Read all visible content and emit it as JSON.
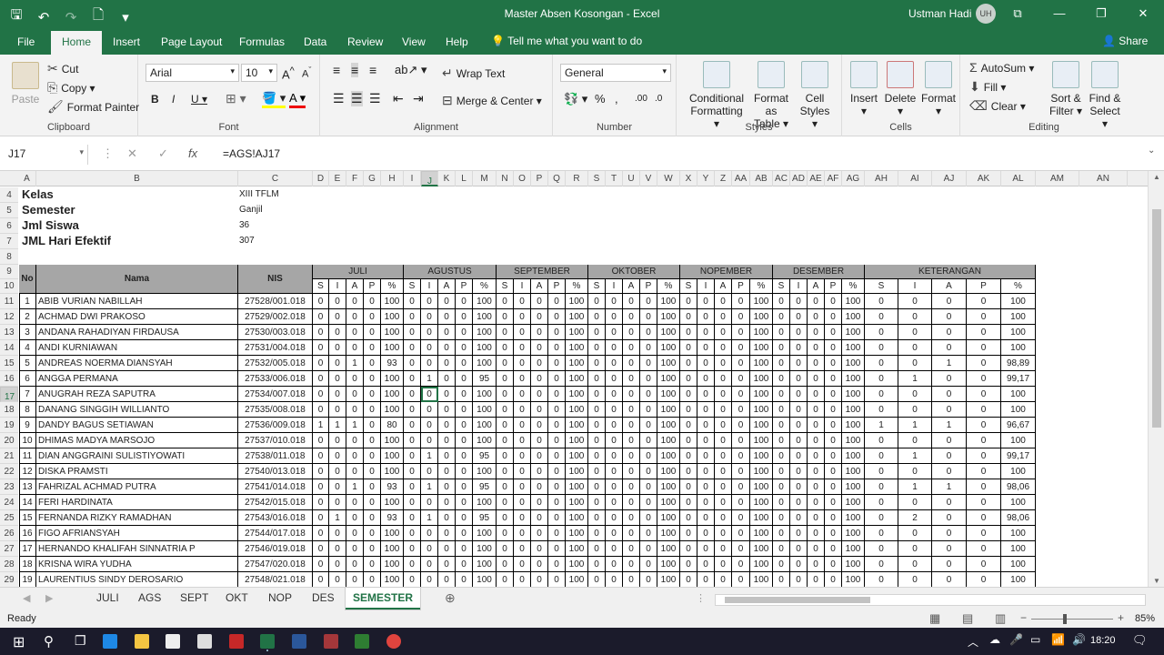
{
  "titlebar": {
    "title": "Master Absen Kosongan  -  Excel",
    "user": "Ustman Hadi",
    "initials": "UH"
  },
  "ribbon_tabs": [
    "File",
    "Home",
    "Insert",
    "Page Layout",
    "Formulas",
    "Data",
    "Review",
    "View",
    "Help"
  ],
  "tell_me": "Tell me what you want to do",
  "share": "Share",
  "clipboard": {
    "paste": "Paste",
    "cut": "Cut",
    "copy": "Copy",
    "painter": "Format Painter",
    "label": "Clipboard"
  },
  "font": {
    "name": "Arial",
    "size": "10",
    "label": "Font"
  },
  "alignment": {
    "wrap": "Wrap Text",
    "merge": "Merge & Center",
    "label": "Alignment"
  },
  "number": {
    "format": "General",
    "label": "Number"
  },
  "styles": {
    "cond": "Conditional",
    "cond2": "Formatting",
    "fmt": "Format as",
    "fmt2": "Table",
    "cell": "Cell",
    "cell2": "Styles",
    "label": "Styles"
  },
  "cells": {
    "insert": "Insert",
    "delete": "Delete",
    "format": "Format",
    "label": "Cells"
  },
  "editing": {
    "autosum": "AutoSum",
    "fill": "Fill",
    "clear": "Clear",
    "sort": "Sort &",
    "sort2": "Filter",
    "find": "Find &",
    "find2": "Select",
    "label": "Editing"
  },
  "namebox": "J17",
  "formula": "=AGS!AJ17",
  "columns": [
    "A",
    "B",
    "C",
    "D",
    "E",
    "F",
    "G",
    "H",
    "I",
    "J",
    "K",
    "L",
    "M",
    "N",
    "O",
    "P",
    "Q",
    "R",
    "S",
    "T",
    "U",
    "V",
    "W",
    "X",
    "Y",
    "Z",
    "AA",
    "AB",
    "AC",
    "AD",
    "AE",
    "AF",
    "AG",
    "AH",
    "AI",
    "AJ",
    "AK",
    "AL",
    "AM",
    "AN"
  ],
  "info": [
    {
      "label": "Kelas",
      "value": "XIII TFLM"
    },
    {
      "label": "Semester",
      "value": "Ganjil"
    },
    {
      "label": "Jml Siswa",
      "value": "36"
    },
    {
      "label": "JML Hari Efektif",
      "value": "307"
    }
  ],
  "table_header": {
    "no": "No",
    "nama": "Nama",
    "nis": "NIS",
    "months": [
      "JULI",
      "AGUSTUS",
      "SEPTEMBER",
      "OKTOBER",
      "NOPEMBER",
      "DESEMBER",
      "KETERANGAN"
    ],
    "sub": [
      "S",
      "I",
      "A",
      "P",
      "%"
    ]
  },
  "students": [
    [
      "1",
      "ABIB VURIAN NABILLAH",
      "27528/001.018",
      "0,0,0,0,100",
      "0,0,0,0,100",
      "0,0,0,0,100",
      "0,0,0,0,100",
      "0,0,0,0,100",
      "0,0,0,0,100",
      "0,0,0,0,100"
    ],
    [
      "2",
      "ACHMAD DWI PRAKOSO",
      "27529/002.018",
      "0,0,0,0,100",
      "0,0,0,0,100",
      "0,0,0,0,100",
      "0,0,0,0,100",
      "0,0,0,0,100",
      "0,0,0,0,100",
      "0,0,0,0,100"
    ],
    [
      "3",
      "ANDANA RAHADIYAN FIRDAUSA",
      "27530/003.018",
      "0,0,0,0,100",
      "0,0,0,0,100",
      "0,0,0,0,100",
      "0,0,0,0,100",
      "0,0,0,0,100",
      "0,0,0,0,100",
      "0,0,0,0,100"
    ],
    [
      "4",
      "ANDI KURNIAWAN",
      "27531/004.018",
      "0,0,0,0,100",
      "0,0,0,0,100",
      "0,0,0,0,100",
      "0,0,0,0,100",
      "0,0,0,0,100",
      "0,0,0,0,100",
      "0,0,0,0,100"
    ],
    [
      "5",
      "ANDREAS NOERMA DIANSYAH",
      "27532/005.018",
      "0,0,1,0,93",
      "0,0,0,0,100",
      "0,0,0,0,100",
      "0,0,0,0,100",
      "0,0,0,0,100",
      "0,0,0,0,100",
      "0,0,1,0,98,89"
    ],
    [
      "6",
      "ANGGA PERMANA",
      "27533/006.018",
      "0,0,0,0,100",
      "0,1,0,0,95",
      "0,0,0,0,100",
      "0,0,0,0,100",
      "0,0,0,0,100",
      "0,0,0,0,100",
      "0,1,0,0,99,17"
    ],
    [
      "7",
      "ANUGRAH REZA SAPUTRA",
      "27534/007.018",
      "0,0,0,0,100",
      "0,0,0,0,100",
      "0,0,0,0,100",
      "0,0,0,0,100",
      "0,0,0,0,100",
      "0,0,0,0,100",
      "0,0,0,0,100"
    ],
    [
      "8",
      "DANANG SINGGIH WILLIANTO",
      "27535/008.018",
      "0,0,0,0,100",
      "0,0,0,0,100",
      "0,0,0,0,100",
      "0,0,0,0,100",
      "0,0,0,0,100",
      "0,0,0,0,100",
      "0,0,0,0,100"
    ],
    [
      "9",
      "DANDY BAGUS SETIAWAN",
      "27536/009.018",
      "1,1,1,0,80",
      "0,0,0,0,100",
      "0,0,0,0,100",
      "0,0,0,0,100",
      "0,0,0,0,100",
      "0,0,0,0,100",
      "1,1,1,0,96,67"
    ],
    [
      "10",
      "DHIMAS MADYA MARSOJO",
      "27537/010.018",
      "0,0,0,0,100",
      "0,0,0,0,100",
      "0,0,0,0,100",
      "0,0,0,0,100",
      "0,0,0,0,100",
      "0,0,0,0,100",
      "0,0,0,0,100"
    ],
    [
      "11",
      "DIAN ANGGRAINI SULISTIYOWATI",
      "27538/011.018",
      "0,0,0,0,100",
      "0,1,0,0,95",
      "0,0,0,0,100",
      "0,0,0,0,100",
      "0,0,0,0,100",
      "0,0,0,0,100",
      "0,1,0,0,99,17"
    ],
    [
      "12",
      "DISKA PRAMSTI",
      "27540/013.018",
      "0,0,0,0,100",
      "0,0,0,0,100",
      "0,0,0,0,100",
      "0,0,0,0,100",
      "0,0,0,0,100",
      "0,0,0,0,100",
      "0,0,0,0,100"
    ],
    [
      "13",
      "FAHRIZAL ACHMAD PUTRA",
      "27541/014.018",
      "0,0,1,0,93",
      "0,1,0,0,95",
      "0,0,0,0,100",
      "0,0,0,0,100",
      "0,0,0,0,100",
      "0,0,0,0,100",
      "0,1,1,0,98,06"
    ],
    [
      "14",
      "FERI HARDINATA",
      "27542/015.018",
      "0,0,0,0,100",
      "0,0,0,0,100",
      "0,0,0,0,100",
      "0,0,0,0,100",
      "0,0,0,0,100",
      "0,0,0,0,100",
      "0,0,0,0,100"
    ],
    [
      "15",
      "FERNANDA RIZKY RAMADHAN",
      "27543/016.018",
      "0,1,0,0,93",
      "0,1,0,0,95",
      "0,0,0,0,100",
      "0,0,0,0,100",
      "0,0,0,0,100",
      "0,0,0,0,100",
      "0,2,0,0,98,06"
    ],
    [
      "16",
      "FIGO AFRIANSYAH",
      "27544/017.018",
      "0,0,0,0,100",
      "0,0,0,0,100",
      "0,0,0,0,100",
      "0,0,0,0,100",
      "0,0,0,0,100",
      "0,0,0,0,100",
      "0,0,0,0,100"
    ],
    [
      "17",
      "HERNANDO KHALIFAH SINNATRIA P",
      "27546/019.018",
      "0,0,0,0,100",
      "0,0,0,0,100",
      "0,0,0,0,100",
      "0,0,0,0,100",
      "0,0,0,0,100",
      "0,0,0,0,100",
      "0,0,0,0,100"
    ],
    [
      "18",
      "KRISNA WIRA YUDHA",
      "27547/020.018",
      "0,0,0,0,100",
      "0,0,0,0,100",
      "0,0,0,0,100",
      "0,0,0,0,100",
      "0,0,0,0,100",
      "0,0,0,0,100",
      "0,0,0,0,100"
    ],
    [
      "19",
      "LAURENTIUS SINDY DEROSARIO",
      "27548/021.018",
      "0,0,0,0,100",
      "0,0,0,0,100",
      "0,0,0,0,100",
      "0,0,0,0,100",
      "0,0,0,0,100",
      "0,0,0,0,100",
      "0,0,0,0,100"
    ]
  ],
  "sheets": [
    "JULI",
    "AGS",
    "SEPT",
    "OKT",
    "NOP",
    "DES",
    "SEMESTER"
  ],
  "status": {
    "ready": "Ready",
    "zoom": "85%",
    "time": "18:20"
  }
}
